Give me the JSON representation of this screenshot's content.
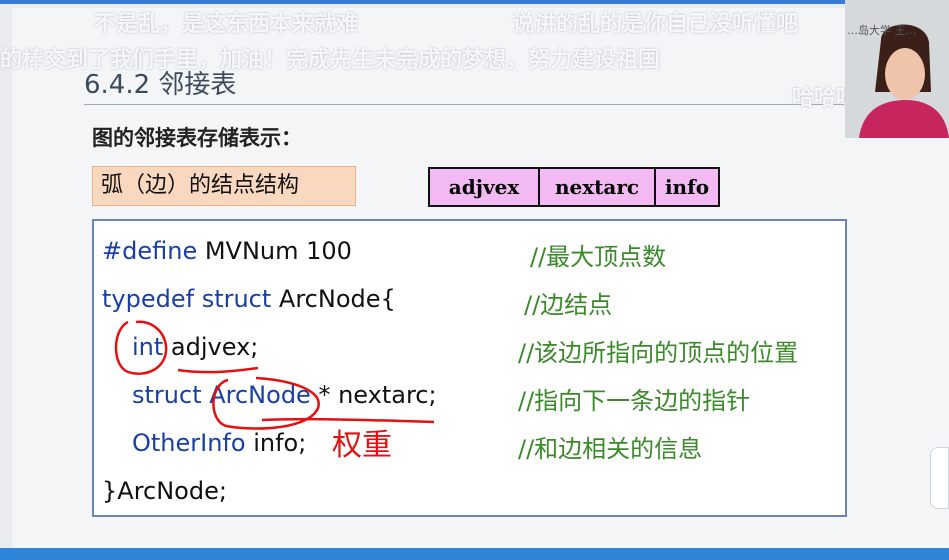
{
  "slide": {
    "section_title": "6.4.2 邻接表",
    "subtitle": "图的邻接表存储表示：",
    "struct_label": "弧（边）的结点结构",
    "node_fields": [
      "adjvex",
      "nextarc",
      "info"
    ]
  },
  "code": {
    "line1_kw": "#define",
    "line1_rest": " MVNum 100",
    "line1_comment": "//最大顶点数",
    "line2_kw": "typedef struct",
    "line2_rest": " ArcNode{",
    "line2_comment": "//边结点",
    "line3_kw": "int",
    "line3_rest": " adjvex;",
    "line3_comment": "//该边所指向的顶点的位置",
    "line4_kw": "struct ArcNode",
    "line4_rest": " * nextarc;",
    "line4_comment": "//指向下一条边的指针",
    "line5_kw": "OtherInfo",
    "line5_rest": " info;",
    "line5_comment": "//和边相关的信息",
    "line6": "}ArcNode;"
  },
  "annotation": "权重",
  "danmaku": [
    "不是乱，是这东西本来就难",
    "说讲的乱的是你自己没听懂吧",
    "的棒交到了我们手里，加油！完成先生未完成的梦想，努力建设祖国",
    "哈哈哈哈哈"
  ],
  "webcam": {
    "label": "…岛大学 王…"
  },
  "colors": {
    "keyword": "#1a3ea8",
    "comment": "#3a8a2a",
    "annotation": "#e60f0f",
    "field_fill": "#f3b9f2"
  }
}
